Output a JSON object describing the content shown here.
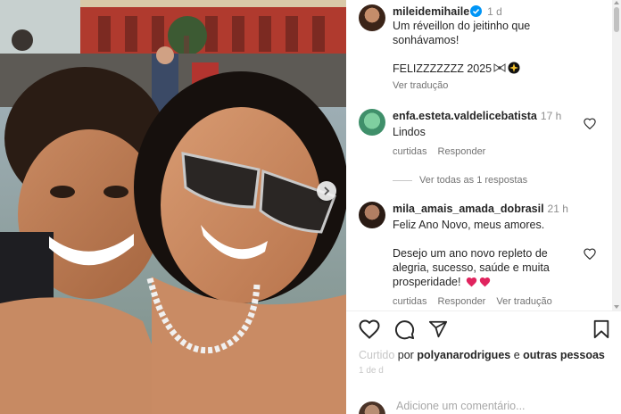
{
  "post": {
    "photo_alt": "selfie",
    "author": "mileidemihaile",
    "time": "1 d",
    "caption_lines": [
      "Um réveillon do jeitinho que",
      "sonhávamos!",
      "",
      "FELIZZZZZZZ 2025"
    ],
    "caption_emojis": [
      "bow-emoji",
      "sparkle-emoji"
    ],
    "translate_label": "Ver tradução"
  },
  "comments": [
    {
      "user": "enfa.esteta.valdelicebatista",
      "time": "17 h",
      "text": "Lindos",
      "likes_label": "curtidas",
      "reply_label": "Responder"
    },
    {
      "user": "mila_amais_amada_dobrasil",
      "time": "21 h",
      "text": "Feliz Ano Novo, meus amores.\n\nDesejo um ano novo repleto de\nalegria, sucesso, saúde e muita\nprosperidade!",
      "likes_label": "curtidas",
      "reply_label": "Responder",
      "translate_label": "Ver tradução"
    }
  ],
  "replies_label": "Ver todas as 1 respostas",
  "liked_by": {
    "prefix": "Curtido",
    "by_label": "por",
    "user": "polyanarodrigues",
    "connector": "e",
    "others": "outras pessoas"
  },
  "date_label": "1 de d",
  "add_comment_placeholder": "Adicione um comentário...",
  "colors": {
    "verified": "#0095f6",
    "heart_red": "#ed4956",
    "muted": "#737373"
  }
}
